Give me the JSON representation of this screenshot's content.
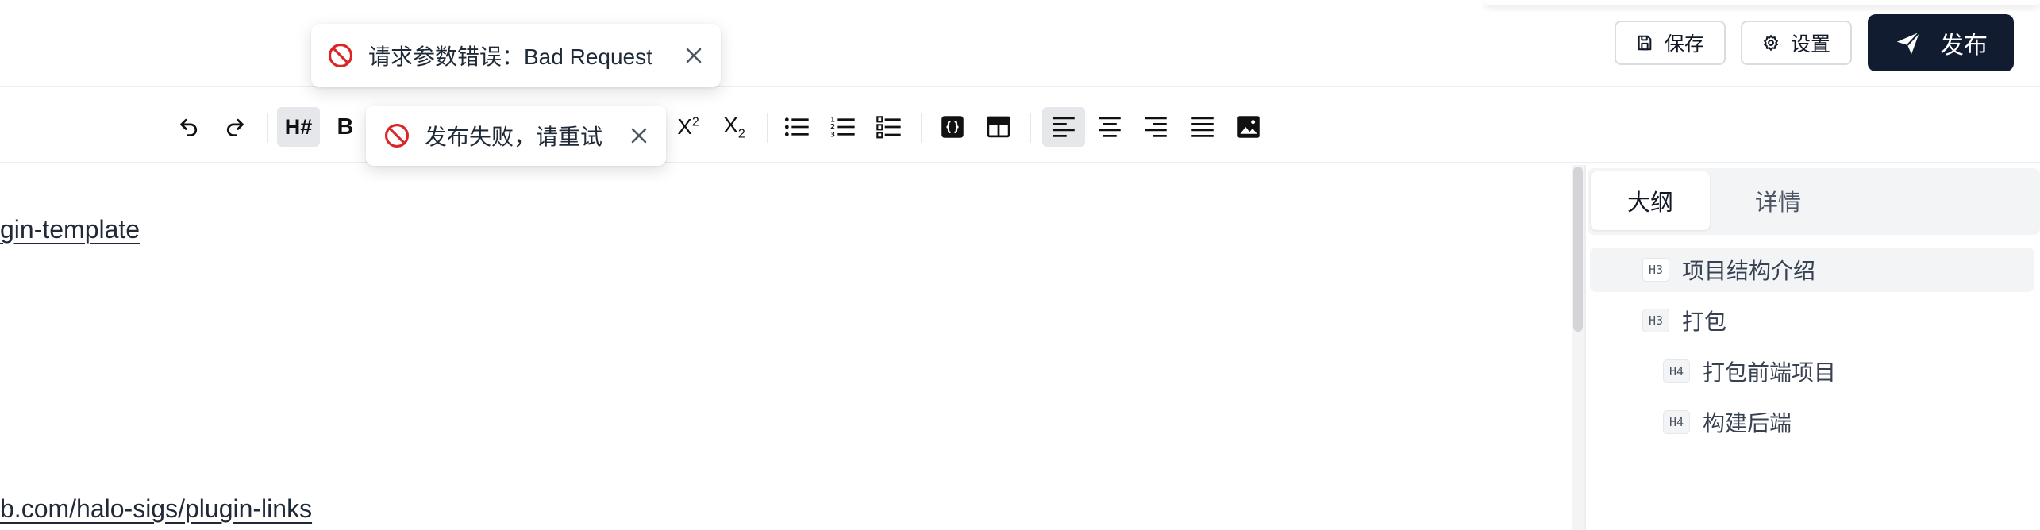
{
  "header": {
    "save_label": "保存",
    "settings_label": "设置",
    "publish_label": "发布"
  },
  "toolbar": {
    "heading_label": "H#",
    "bold_label": "B",
    "superscript_label": "X",
    "superscript_mark": "2",
    "subscript_label": "X",
    "subscript_mark": "2",
    "items": [
      "undo",
      "redo",
      "heading",
      "bold",
      "superscript",
      "subscript",
      "bullet-list",
      "ordered-list",
      "task-list",
      "code-block",
      "table",
      "align-left",
      "align-center",
      "align-right",
      "align-justify",
      "image"
    ],
    "active": [
      "heading",
      "align-left"
    ]
  },
  "editor": {
    "link_1": "gin-template",
    "link_2": "b.com/halo-sigs/plugin-links"
  },
  "panel": {
    "tab_outline": "大纲",
    "tab_details": "详情",
    "active_tab": "大纲",
    "outline": [
      {
        "level": "H3",
        "text": "项目结构介绍",
        "active": true
      },
      {
        "level": "H3",
        "text": "打包",
        "active": false
      },
      {
        "level": "H4",
        "text": "打包前端项目",
        "active": false
      },
      {
        "level": "H4",
        "text": "构建后端",
        "active": false
      }
    ]
  },
  "toasts": [
    {
      "message": "请求参数错误：Bad Request",
      "type": "error"
    },
    {
      "message": "发布失败，请重试",
      "type": "error"
    }
  ],
  "colors": {
    "publish_bg": "#111c31",
    "error_icon": "#dc2626",
    "active_bg": "#e5e7eb"
  }
}
